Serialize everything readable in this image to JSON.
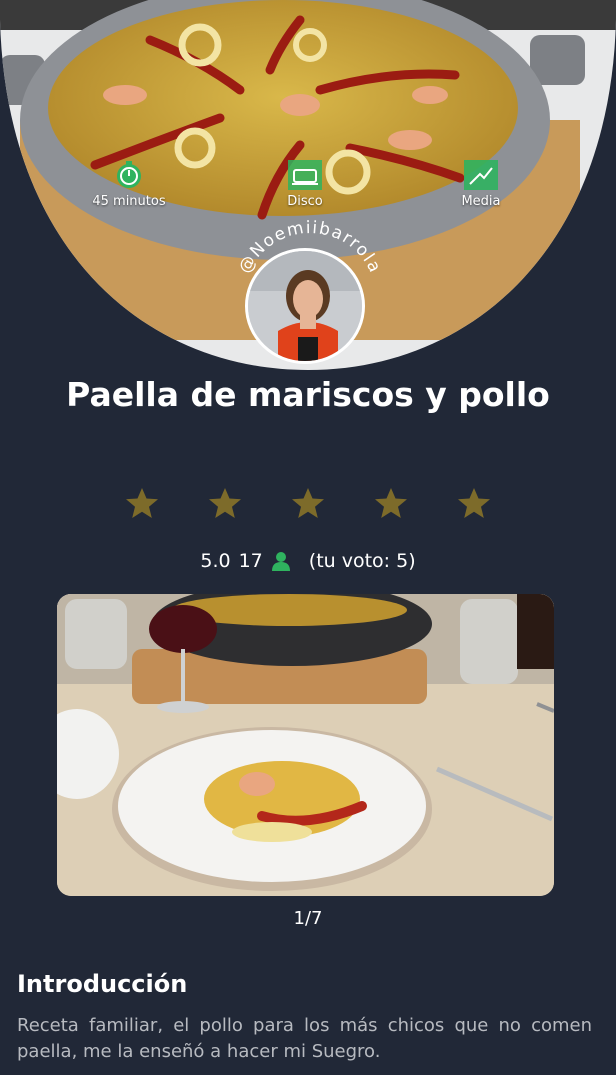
{
  "hero": {
    "time_label": "45 minutos",
    "type_label": "Disco",
    "difficulty_label": "Media",
    "author_handle": "@Noemiibarrola",
    "icon_color": "#2fb35f"
  },
  "recipe": {
    "title": "Paella de mariscos y pollo",
    "star_color": "#7d6b2a",
    "stars_filled": 5,
    "rating": "5.0",
    "votes": "17",
    "user_vote": "(tu voto: 5)"
  },
  "gallery": {
    "counter": "1/7"
  },
  "intro": {
    "heading": "Introducción",
    "text": "Receta familiar, el pollo para los más chicos que no comen paella, me la enseñó a hacer mi Suegro."
  }
}
